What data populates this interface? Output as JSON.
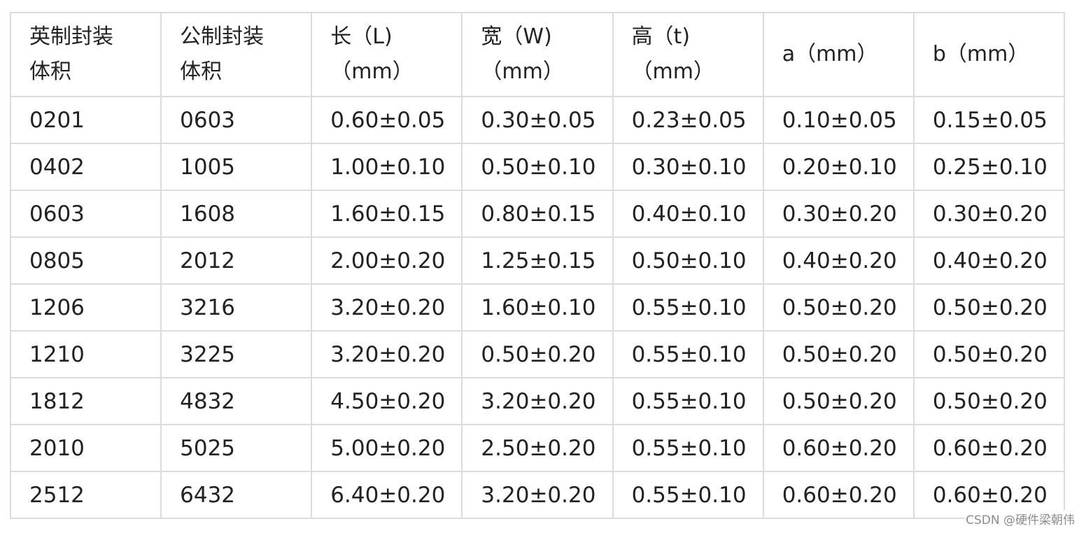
{
  "table": {
    "headers": [
      [
        "英制封装",
        "体积"
      ],
      [
        "公制封装",
        "体积"
      ],
      [
        "长（L)",
        "（mm）"
      ],
      [
        "宽（W)",
        "（mm）"
      ],
      [
        "高（t)",
        "（mm）"
      ],
      [
        "a（mm）"
      ],
      [
        "b（mm）"
      ]
    ],
    "rows": [
      [
        "0201",
        "0603",
        "0.60±0.05",
        "0.30±0.05",
        "0.23±0.05",
        "0.10±0.05",
        "0.15±0.05"
      ],
      [
        "0402",
        "1005",
        "1.00±0.10",
        "0.50±0.10",
        "0.30±0.10",
        "0.20±0.10",
        "0.25±0.10"
      ],
      [
        "0603",
        "1608",
        "1.60±0.15",
        "0.80±0.15",
        "0.40±0.10",
        "0.30±0.20",
        "0.30±0.20"
      ],
      [
        "0805",
        "2012",
        "2.00±0.20",
        "1.25±0.15",
        "0.50±0.10",
        "0.40±0.20",
        "0.40±0.20"
      ],
      [
        "1206",
        "3216",
        "3.20±0.20",
        "1.60±0.10",
        "0.55±0.10",
        "0.50±0.20",
        "0.50±0.20"
      ],
      [
        "1210",
        "3225",
        "3.20±0.20",
        "0.50±0.20",
        "0.55±0.10",
        "0.50±0.20",
        "0.50±0.20"
      ],
      [
        "1812",
        "4832",
        "4.50±0.20",
        "3.20±0.20",
        "0.55±0.10",
        "0.50±0.20",
        "0.50±0.20"
      ],
      [
        "2010",
        "5025",
        "5.00±0.20",
        "2.50±0.20",
        "0.55±0.10",
        "0.60±0.20",
        "0.60±0.20"
      ],
      [
        "2512",
        "6432",
        "6.40±0.20",
        "3.20±0.20",
        "0.55±0.10",
        "0.60±0.20",
        "0.60±0.20"
      ]
    ]
  },
  "watermark": "CSDN @硬件梁朝伟"
}
